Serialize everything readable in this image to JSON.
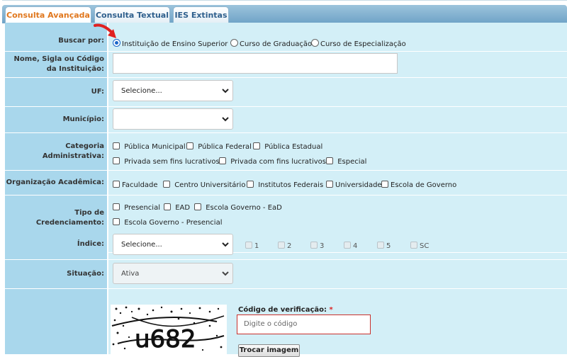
{
  "tabs": [
    {
      "label": "Consulta Avançada",
      "active": true
    },
    {
      "label": "Consulta Textual",
      "active": false
    },
    {
      "label": "IES Extintas",
      "active": false
    }
  ],
  "form": {
    "buscar_por": {
      "label": "Buscar por:",
      "options": [
        "Instituição de Ensino Superior",
        "Curso de Graduação",
        "Curso de Especialização"
      ],
      "selected": "Instituição de Ensino Superior"
    },
    "nome": {
      "label": "Nome, Sigla ou Código da Instituição:",
      "value": ""
    },
    "uf": {
      "label": "UF:",
      "value": "Selecione..."
    },
    "municipio": {
      "label": "Município:",
      "value": ""
    },
    "categoria": {
      "label": "Categoria Administrativa:",
      "options": [
        "Pública Municipal",
        "Pública Federal",
        "Pública Estadual",
        "Privada sem fins lucrativos",
        "Privada com fins lucrativos",
        "Especial"
      ]
    },
    "organizacao": {
      "label": "Organização Acadêmica:",
      "options": [
        "Faculdade",
        "Centro Universitário",
        "Institutos Federais",
        "Universidade",
        "Escola de Governo"
      ]
    },
    "credenciamento": {
      "label": "Tipo de Credenciamento:",
      "options": [
        "Presencial",
        "EAD",
        "Escola Governo - EaD",
        "Escola Governo - Presencial"
      ]
    },
    "indice": {
      "label": "Índice:",
      "value": "Selecione...",
      "options": [
        "1",
        "2",
        "3",
        "4",
        "5",
        "SC"
      ]
    },
    "situacao": {
      "label": "Situação:",
      "value": "Ativa"
    },
    "verificacao": {
      "label": "Código de verificação:",
      "required_mark": "*",
      "placeholder": "Digite o código",
      "captcha_text": "u682",
      "button": "Trocar imagem"
    }
  },
  "colors": {
    "accent": "#e0771d",
    "tab_text": "#2e5f8c",
    "label_bg": "#a9d7ec",
    "field_bg": "#d3eff7",
    "arrow": "#e02020"
  }
}
